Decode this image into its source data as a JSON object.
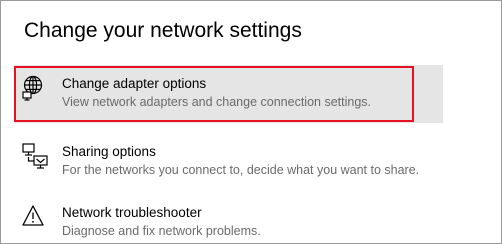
{
  "page": {
    "title": "Change your network settings"
  },
  "options": [
    {
      "title": "Change adapter options",
      "description": "View network adapters and change connection settings.",
      "icon": "network-adapter-globe-icon",
      "highlighted": true
    },
    {
      "title": "Sharing options",
      "description": "For the networks you connect to, decide what you want to share.",
      "icon": "sharing-options-icon",
      "highlighted": false
    },
    {
      "title": "Network troubleshooter",
      "description": "Diagnose and fix network problems.",
      "icon": "warning-triangle-icon",
      "highlighted": false
    }
  ],
  "colors": {
    "annotation_outline": "#e81123",
    "hover_background": "#e5e5e5",
    "description_text": "#6a6a6a"
  }
}
